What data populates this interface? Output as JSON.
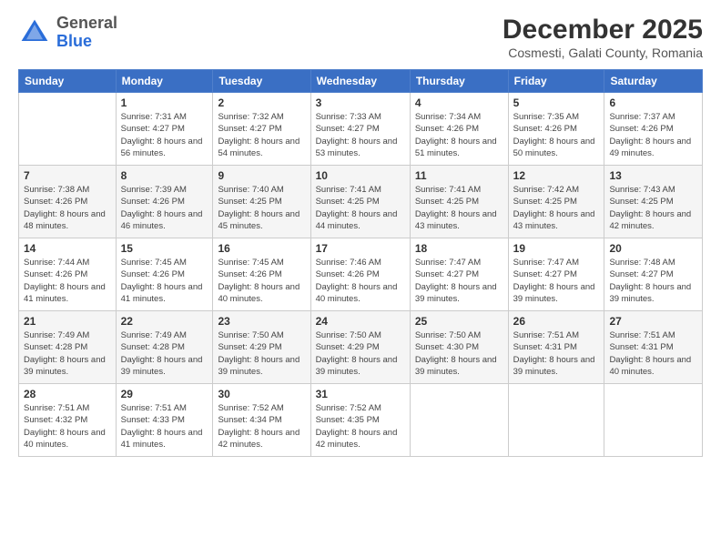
{
  "logo": {
    "general": "General",
    "blue": "Blue"
  },
  "header": {
    "month": "December 2025",
    "location": "Cosmesti, Galati County, Romania"
  },
  "days_of_week": [
    "Sunday",
    "Monday",
    "Tuesday",
    "Wednesday",
    "Thursday",
    "Friday",
    "Saturday"
  ],
  "weeks": [
    [
      {
        "num": "",
        "sunrise": "",
        "sunset": "",
        "daylight": ""
      },
      {
        "num": "1",
        "sunrise": "Sunrise: 7:31 AM",
        "sunset": "Sunset: 4:27 PM",
        "daylight": "Daylight: 8 hours and 56 minutes."
      },
      {
        "num": "2",
        "sunrise": "Sunrise: 7:32 AM",
        "sunset": "Sunset: 4:27 PM",
        "daylight": "Daylight: 8 hours and 54 minutes."
      },
      {
        "num": "3",
        "sunrise": "Sunrise: 7:33 AM",
        "sunset": "Sunset: 4:27 PM",
        "daylight": "Daylight: 8 hours and 53 minutes."
      },
      {
        "num": "4",
        "sunrise": "Sunrise: 7:34 AM",
        "sunset": "Sunset: 4:26 PM",
        "daylight": "Daylight: 8 hours and 51 minutes."
      },
      {
        "num": "5",
        "sunrise": "Sunrise: 7:35 AM",
        "sunset": "Sunset: 4:26 PM",
        "daylight": "Daylight: 8 hours and 50 minutes."
      },
      {
        "num": "6",
        "sunrise": "Sunrise: 7:37 AM",
        "sunset": "Sunset: 4:26 PM",
        "daylight": "Daylight: 8 hours and 49 minutes."
      }
    ],
    [
      {
        "num": "7",
        "sunrise": "Sunrise: 7:38 AM",
        "sunset": "Sunset: 4:26 PM",
        "daylight": "Daylight: 8 hours and 48 minutes."
      },
      {
        "num": "8",
        "sunrise": "Sunrise: 7:39 AM",
        "sunset": "Sunset: 4:26 PM",
        "daylight": "Daylight: 8 hours and 46 minutes."
      },
      {
        "num": "9",
        "sunrise": "Sunrise: 7:40 AM",
        "sunset": "Sunset: 4:25 PM",
        "daylight": "Daylight: 8 hours and 45 minutes."
      },
      {
        "num": "10",
        "sunrise": "Sunrise: 7:41 AM",
        "sunset": "Sunset: 4:25 PM",
        "daylight": "Daylight: 8 hours and 44 minutes."
      },
      {
        "num": "11",
        "sunrise": "Sunrise: 7:41 AM",
        "sunset": "Sunset: 4:25 PM",
        "daylight": "Daylight: 8 hours and 43 minutes."
      },
      {
        "num": "12",
        "sunrise": "Sunrise: 7:42 AM",
        "sunset": "Sunset: 4:25 PM",
        "daylight": "Daylight: 8 hours and 43 minutes."
      },
      {
        "num": "13",
        "sunrise": "Sunrise: 7:43 AM",
        "sunset": "Sunset: 4:25 PM",
        "daylight": "Daylight: 8 hours and 42 minutes."
      }
    ],
    [
      {
        "num": "14",
        "sunrise": "Sunrise: 7:44 AM",
        "sunset": "Sunset: 4:26 PM",
        "daylight": "Daylight: 8 hours and 41 minutes."
      },
      {
        "num": "15",
        "sunrise": "Sunrise: 7:45 AM",
        "sunset": "Sunset: 4:26 PM",
        "daylight": "Daylight: 8 hours and 41 minutes."
      },
      {
        "num": "16",
        "sunrise": "Sunrise: 7:45 AM",
        "sunset": "Sunset: 4:26 PM",
        "daylight": "Daylight: 8 hours and 40 minutes."
      },
      {
        "num": "17",
        "sunrise": "Sunrise: 7:46 AM",
        "sunset": "Sunset: 4:26 PM",
        "daylight": "Daylight: 8 hours and 40 minutes."
      },
      {
        "num": "18",
        "sunrise": "Sunrise: 7:47 AM",
        "sunset": "Sunset: 4:27 PM",
        "daylight": "Daylight: 8 hours and 39 minutes."
      },
      {
        "num": "19",
        "sunrise": "Sunrise: 7:47 AM",
        "sunset": "Sunset: 4:27 PM",
        "daylight": "Daylight: 8 hours and 39 minutes."
      },
      {
        "num": "20",
        "sunrise": "Sunrise: 7:48 AM",
        "sunset": "Sunset: 4:27 PM",
        "daylight": "Daylight: 8 hours and 39 minutes."
      }
    ],
    [
      {
        "num": "21",
        "sunrise": "Sunrise: 7:49 AM",
        "sunset": "Sunset: 4:28 PM",
        "daylight": "Daylight: 8 hours and 39 minutes."
      },
      {
        "num": "22",
        "sunrise": "Sunrise: 7:49 AM",
        "sunset": "Sunset: 4:28 PM",
        "daylight": "Daylight: 8 hours and 39 minutes."
      },
      {
        "num": "23",
        "sunrise": "Sunrise: 7:50 AM",
        "sunset": "Sunset: 4:29 PM",
        "daylight": "Daylight: 8 hours and 39 minutes."
      },
      {
        "num": "24",
        "sunrise": "Sunrise: 7:50 AM",
        "sunset": "Sunset: 4:29 PM",
        "daylight": "Daylight: 8 hours and 39 minutes."
      },
      {
        "num": "25",
        "sunrise": "Sunrise: 7:50 AM",
        "sunset": "Sunset: 4:30 PM",
        "daylight": "Daylight: 8 hours and 39 minutes."
      },
      {
        "num": "26",
        "sunrise": "Sunrise: 7:51 AM",
        "sunset": "Sunset: 4:31 PM",
        "daylight": "Daylight: 8 hours and 39 minutes."
      },
      {
        "num": "27",
        "sunrise": "Sunrise: 7:51 AM",
        "sunset": "Sunset: 4:31 PM",
        "daylight": "Daylight: 8 hours and 40 minutes."
      }
    ],
    [
      {
        "num": "28",
        "sunrise": "Sunrise: 7:51 AM",
        "sunset": "Sunset: 4:32 PM",
        "daylight": "Daylight: 8 hours and 40 minutes."
      },
      {
        "num": "29",
        "sunrise": "Sunrise: 7:51 AM",
        "sunset": "Sunset: 4:33 PM",
        "daylight": "Daylight: 8 hours and 41 minutes."
      },
      {
        "num": "30",
        "sunrise": "Sunrise: 7:52 AM",
        "sunset": "Sunset: 4:34 PM",
        "daylight": "Daylight: 8 hours and 42 minutes."
      },
      {
        "num": "31",
        "sunrise": "Sunrise: 7:52 AM",
        "sunset": "Sunset: 4:35 PM",
        "daylight": "Daylight: 8 hours and 42 minutes."
      },
      {
        "num": "",
        "sunrise": "",
        "sunset": "",
        "daylight": ""
      },
      {
        "num": "",
        "sunrise": "",
        "sunset": "",
        "daylight": ""
      },
      {
        "num": "",
        "sunrise": "",
        "sunset": "",
        "daylight": ""
      }
    ]
  ]
}
